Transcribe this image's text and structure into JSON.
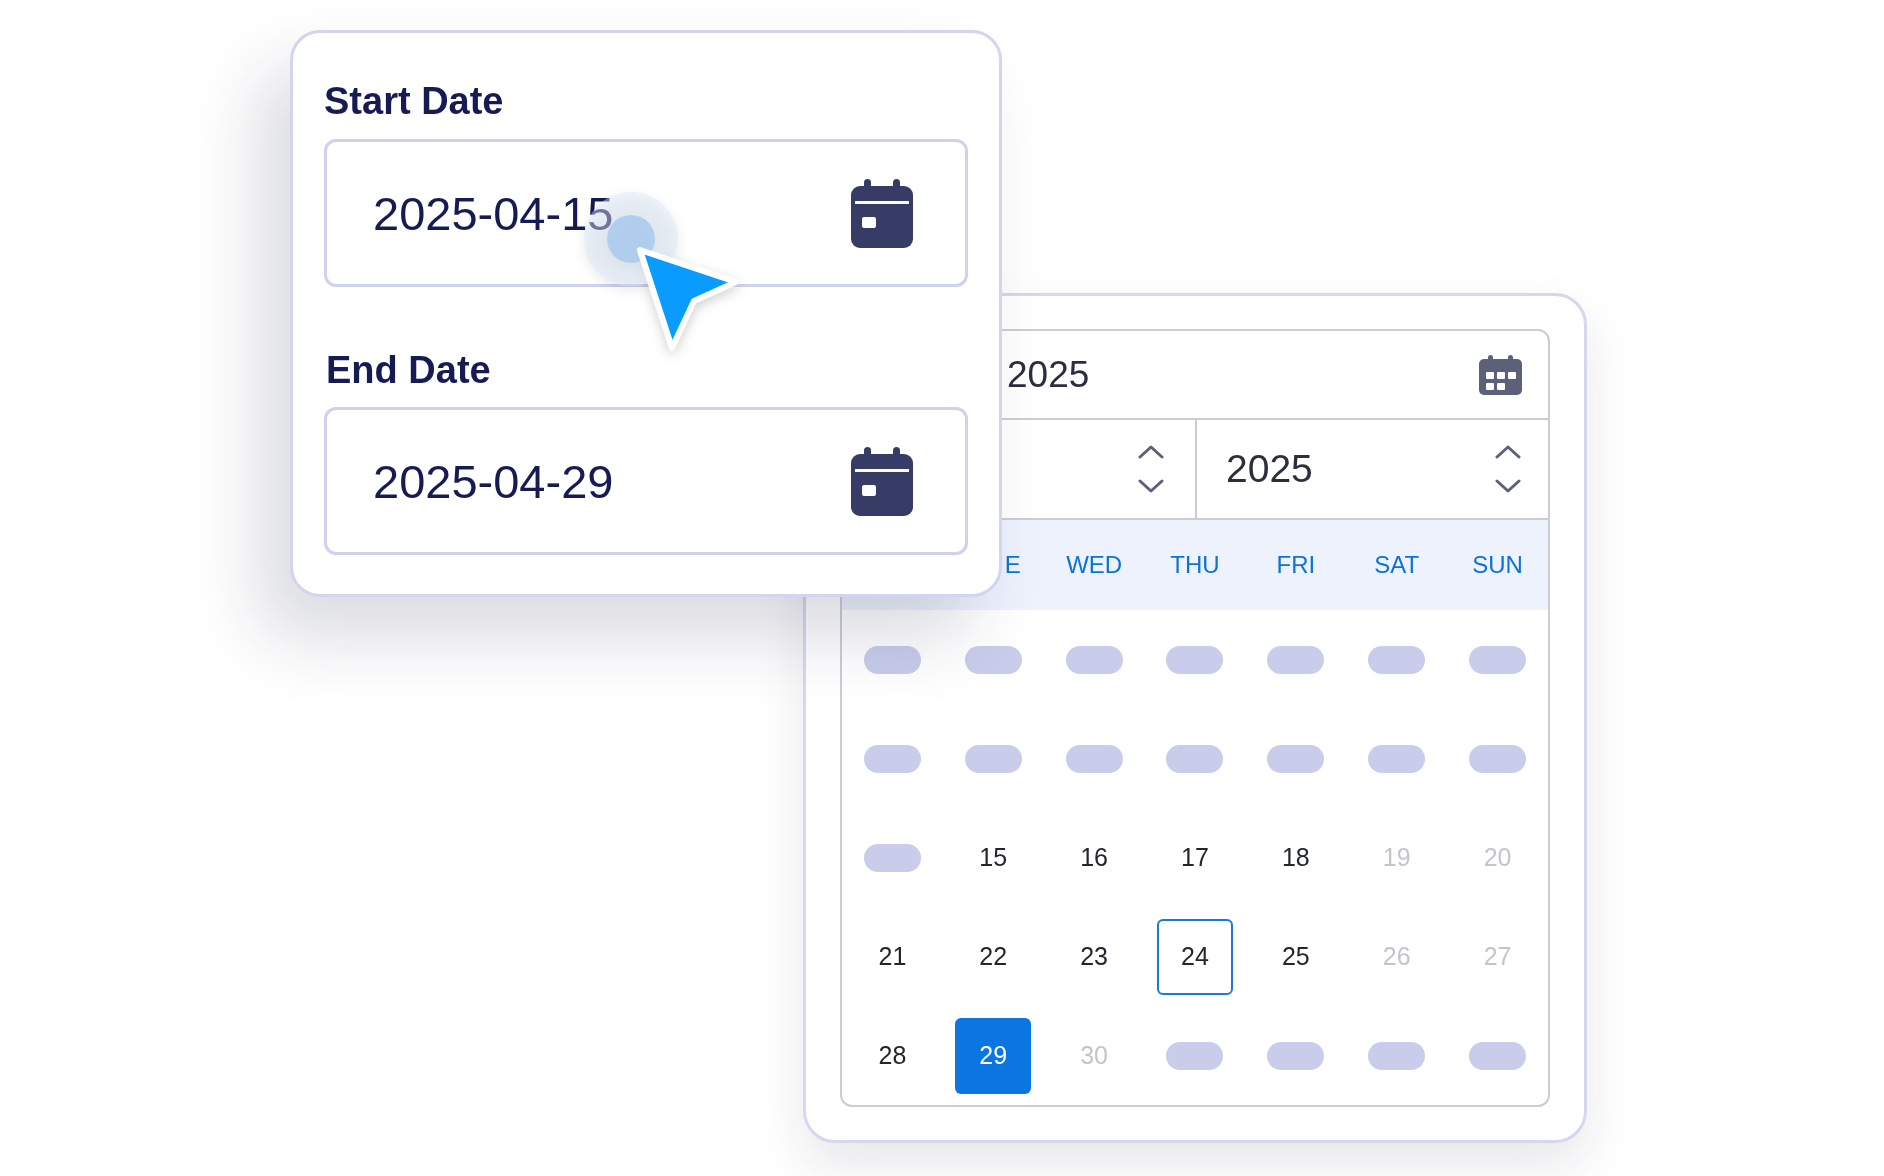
{
  "date_range_form": {
    "fields": [
      {
        "label": "Start Date",
        "value": "2025-04-15"
      },
      {
        "label": "End Date",
        "value": "2025-04-29"
      }
    ]
  },
  "calendar": {
    "date_field": {
      "value": "2025"
    },
    "year_spinner": {
      "value": "2025"
    },
    "weekdays": [
      "E",
      "WED",
      "THU",
      "FRI",
      "SAT",
      "SUN"
    ],
    "weeks": [
      {
        "days": [
          {
            "kind": "placeholder"
          },
          {
            "kind": "placeholder"
          },
          {
            "kind": "placeholder"
          },
          {
            "kind": "placeholder"
          },
          {
            "kind": "placeholder"
          },
          {
            "kind": "placeholder"
          },
          {
            "kind": "placeholder"
          }
        ]
      },
      {
        "days": [
          {
            "kind": "placeholder"
          },
          {
            "kind": "placeholder"
          },
          {
            "kind": "placeholder"
          },
          {
            "kind": "placeholder"
          },
          {
            "kind": "placeholder"
          },
          {
            "kind": "placeholder"
          },
          {
            "kind": "placeholder"
          }
        ]
      },
      {
        "days": [
          {
            "kind": "placeholder"
          },
          {
            "kind": "day",
            "text": "15",
            "selected": false,
            "today": false,
            "disabled": false
          },
          {
            "kind": "day",
            "text": "16",
            "selected": false,
            "today": false,
            "disabled": false
          },
          {
            "kind": "day",
            "text": "17",
            "selected": false,
            "today": false,
            "disabled": false
          },
          {
            "kind": "day",
            "text": "18",
            "selected": false,
            "today": false,
            "disabled": false
          },
          {
            "kind": "day",
            "text": "19",
            "selected": false,
            "today": false,
            "disabled": true
          },
          {
            "kind": "day",
            "text": "20",
            "selected": false,
            "today": false,
            "disabled": true
          }
        ]
      },
      {
        "days": [
          {
            "kind": "day",
            "text": "21",
            "selected": false,
            "today": false,
            "disabled": false
          },
          {
            "kind": "day",
            "text": "22",
            "selected": false,
            "today": false,
            "disabled": false
          },
          {
            "kind": "day",
            "text": "23",
            "selected": false,
            "today": false,
            "disabled": false
          },
          {
            "kind": "day",
            "text": "24",
            "selected": false,
            "today": true,
            "disabled": false
          },
          {
            "kind": "day",
            "text": "25",
            "selected": false,
            "today": false,
            "disabled": false
          },
          {
            "kind": "day",
            "text": "26",
            "selected": false,
            "today": false,
            "disabled": true
          },
          {
            "kind": "day",
            "text": "27",
            "selected": false,
            "today": false,
            "disabled": true
          }
        ]
      },
      {
        "days": [
          {
            "kind": "day",
            "text": "28",
            "selected": false,
            "today": false,
            "disabled": false
          },
          {
            "kind": "day",
            "text": "29",
            "selected": true,
            "today": false,
            "disabled": false
          },
          {
            "kind": "day",
            "text": "30",
            "selected": false,
            "today": false,
            "disabled": true
          },
          {
            "kind": "placeholder"
          },
          {
            "kind": "placeholder"
          },
          {
            "kind": "placeholder"
          },
          {
            "kind": "placeholder"
          }
        ]
      }
    ]
  }
}
